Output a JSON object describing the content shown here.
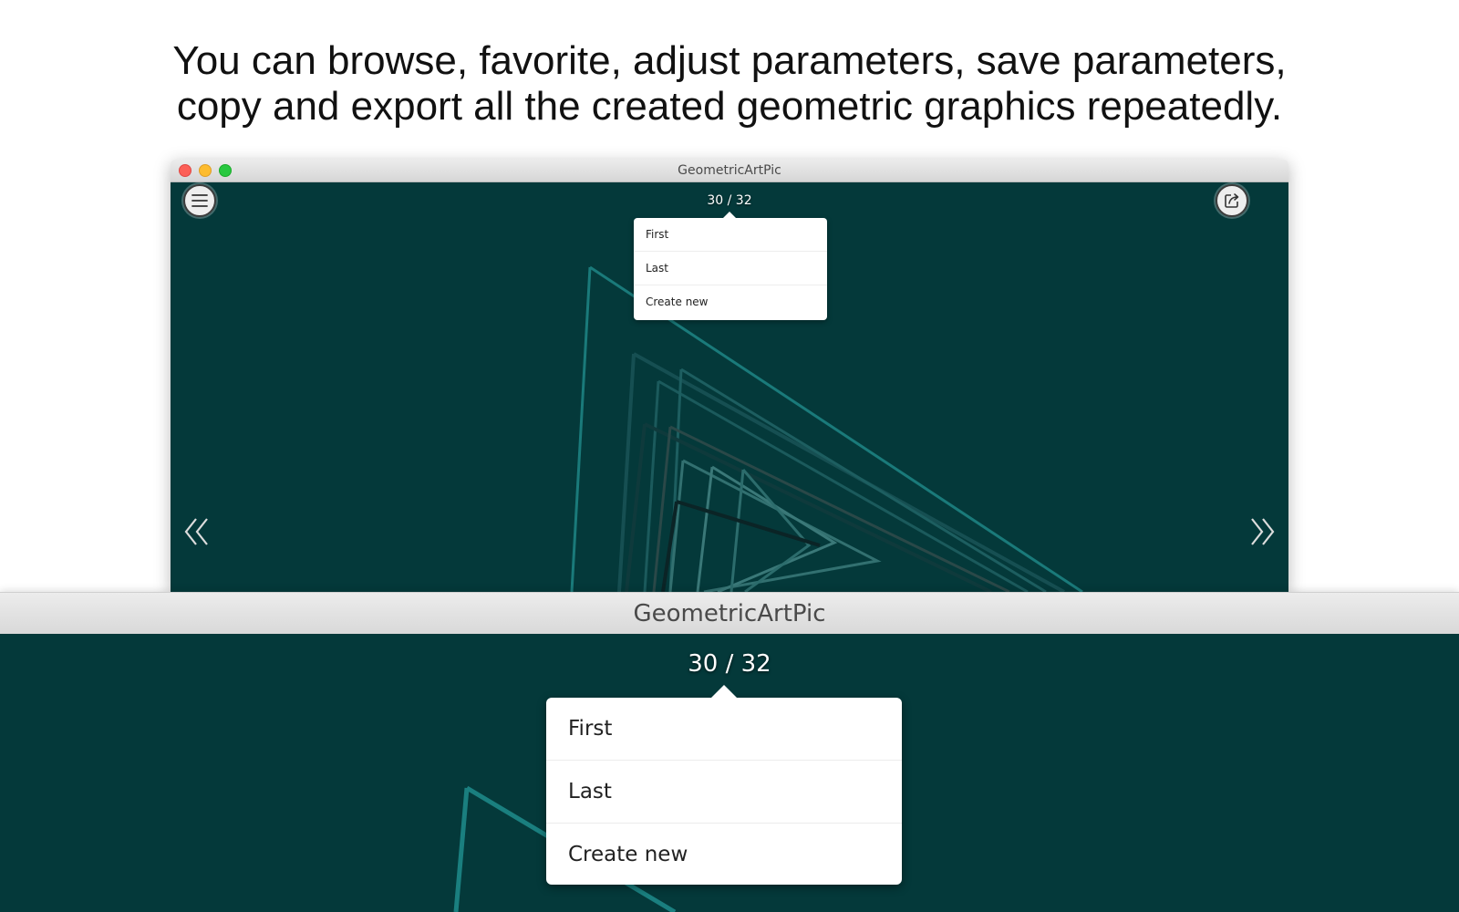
{
  "headline": {
    "line1": "You can browse, favorite, adjust parameters, save parameters,",
    "line2": "copy and export all the created geometric graphics repeatedly."
  },
  "window": {
    "title": "GeometricArtPic",
    "counter": "30 / 32",
    "menu": [
      "First",
      "Last",
      "Create new"
    ]
  },
  "zoom": {
    "title": "GeometricArtPic",
    "counter": "30 / 32",
    "menu": [
      "First",
      "Last",
      "Create new"
    ]
  },
  "icons": {
    "menu": "hamburger-menu-icon",
    "share": "share-export-icon",
    "previous": "double-chevron-left-icon",
    "next": "double-chevron-right-icon"
  },
  "colors": {
    "canvas_background": "#04393a",
    "art_stroke": "#1a7f7f",
    "popup_background": "#ffffff"
  }
}
